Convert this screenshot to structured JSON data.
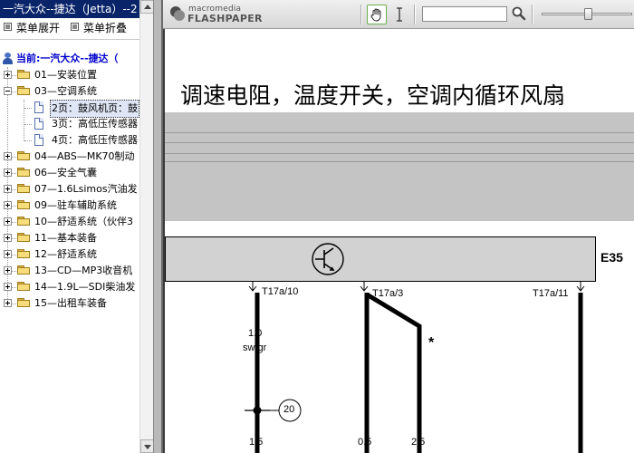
{
  "window": {
    "title": "一汽大众--捷达（Jetta）--2"
  },
  "menu": {
    "expand_label": "菜单展开",
    "collapse_label": "菜单折叠"
  },
  "tree": {
    "root_label": "当前:一汽大众--捷达（",
    "items": [
      {
        "label": "01—安装位置",
        "state": "collapsed"
      },
      {
        "label": "03—空调系统",
        "state": "expanded"
      },
      {
        "label": "2页：鼓风机页：鼓",
        "type": "page",
        "selected": true
      },
      {
        "label": "3页：高低压传感器",
        "type": "page"
      },
      {
        "label": "4页：高低压传感器",
        "type": "page"
      },
      {
        "label": "04—ABS—MK70制动",
        "state": "collapsed"
      },
      {
        "label": "06—安全气囊",
        "state": "collapsed"
      },
      {
        "label": "07—1.6Lsimos汽油发",
        "state": "collapsed"
      },
      {
        "label": "09—驻车辅助系统",
        "state": "collapsed"
      },
      {
        "label": "10—舒适系统（伙伴3",
        "state": "collapsed"
      },
      {
        "label": "11—基本装备",
        "state": "collapsed"
      },
      {
        "label": "12—舒适系统",
        "state": "collapsed"
      },
      {
        "label": "13—CD—MP3收音机",
        "state": "collapsed"
      },
      {
        "label": "14—1.9L—SDI柴油发",
        "state": "collapsed"
      },
      {
        "label": "15—出租车装备",
        "state": "collapsed"
      }
    ]
  },
  "toolbar": {
    "brand_top": "macromedia",
    "brand_product": "FLASHPAPER",
    "search_value": "",
    "zoom_fraction": 0.52
  },
  "document": {
    "title": "调速电阻，温度开关，空调内循环风扇",
    "component_label": "E35",
    "pins": [
      "T17a/10",
      "T17a/3",
      "T17a/11"
    ],
    "wire1_size": "1.0",
    "wire1_color": "sw/gr",
    "junction_number": "20",
    "asterisk": "*",
    "bottom_sizes": [
      "1.5",
      "0.5",
      "2.5"
    ]
  }
}
